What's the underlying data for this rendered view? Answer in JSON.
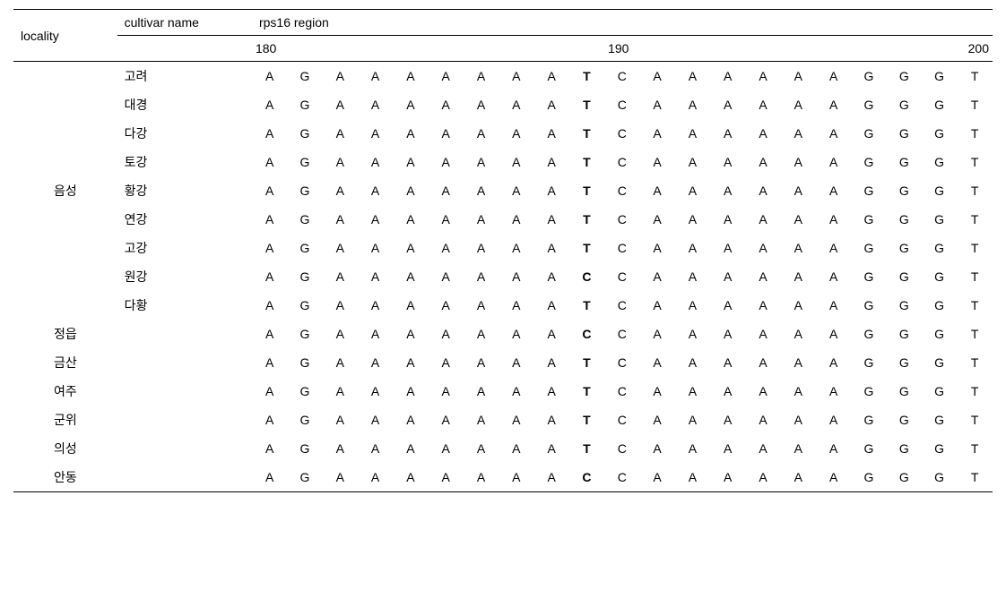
{
  "headers": {
    "locality": "locality",
    "cultivar": "cultivar name",
    "region": "rps16 region",
    "pos_start": "180",
    "pos_mid": "190",
    "pos_end": "200"
  },
  "locality_eumseong": "음성",
  "rows": [
    {
      "locality": "",
      "cultivar": "고려",
      "seq": [
        "A",
        "G",
        "A",
        "A",
        "A",
        "A",
        "A",
        "A",
        "A",
        "T",
        "C",
        "A",
        "A",
        "A",
        "A",
        "A",
        "A",
        "G",
        "G",
        "G",
        "T"
      ],
      "bold_idx": 9
    },
    {
      "locality": "",
      "cultivar": "대경",
      "seq": [
        "A",
        "G",
        "A",
        "A",
        "A",
        "A",
        "A",
        "A",
        "A",
        "T",
        "C",
        "A",
        "A",
        "A",
        "A",
        "A",
        "A",
        "G",
        "G",
        "G",
        "T"
      ],
      "bold_idx": 9
    },
    {
      "locality": "",
      "cultivar": "다강",
      "seq": [
        "A",
        "G",
        "A",
        "A",
        "A",
        "A",
        "A",
        "A",
        "A",
        "T",
        "C",
        "A",
        "A",
        "A",
        "A",
        "A",
        "A",
        "G",
        "G",
        "G",
        "T"
      ],
      "bold_idx": 9
    },
    {
      "locality": "",
      "cultivar": "토강",
      "seq": [
        "A",
        "G",
        "A",
        "A",
        "A",
        "A",
        "A",
        "A",
        "A",
        "T",
        "C",
        "A",
        "A",
        "A",
        "A",
        "A",
        "A",
        "G",
        "G",
        "G",
        "T"
      ],
      "bold_idx": 9
    },
    {
      "locality": "음성",
      "cultivar": "황강",
      "seq": [
        "A",
        "G",
        "A",
        "A",
        "A",
        "A",
        "A",
        "A",
        "A",
        "T",
        "C",
        "A",
        "A",
        "A",
        "A",
        "A",
        "A",
        "G",
        "G",
        "G",
        "T"
      ],
      "bold_idx": 9
    },
    {
      "locality": "",
      "cultivar": "연강",
      "seq": [
        "A",
        "G",
        "A",
        "A",
        "A",
        "A",
        "A",
        "A",
        "A",
        "T",
        "C",
        "A",
        "A",
        "A",
        "A",
        "A",
        "A",
        "G",
        "G",
        "G",
        "T"
      ],
      "bold_idx": 9
    },
    {
      "locality": "",
      "cultivar": "고강",
      "seq": [
        "A",
        "G",
        "A",
        "A",
        "A",
        "A",
        "A",
        "A",
        "A",
        "T",
        "C",
        "A",
        "A",
        "A",
        "A",
        "A",
        "A",
        "G",
        "G",
        "G",
        "T"
      ],
      "bold_idx": 9
    },
    {
      "locality": "",
      "cultivar": "원강",
      "seq": [
        "A",
        "G",
        "A",
        "A",
        "A",
        "A",
        "A",
        "A",
        "A",
        "C",
        "C",
        "A",
        "A",
        "A",
        "A",
        "A",
        "A",
        "G",
        "G",
        "G",
        "T"
      ],
      "bold_idx": 9
    },
    {
      "locality": "",
      "cultivar": "다황",
      "seq": [
        "A",
        "G",
        "A",
        "A",
        "A",
        "A",
        "A",
        "A",
        "A",
        "T",
        "C",
        "A",
        "A",
        "A",
        "A",
        "A",
        "A",
        "G",
        "G",
        "G",
        "T"
      ],
      "bold_idx": 9
    },
    {
      "locality": "정읍",
      "cultivar": "",
      "seq": [
        "A",
        "G",
        "A",
        "A",
        "A",
        "A",
        "A",
        "A",
        "A",
        "C",
        "C",
        "A",
        "A",
        "A",
        "A",
        "A",
        "A",
        "G",
        "G",
        "G",
        "T"
      ],
      "bold_idx": 9
    },
    {
      "locality": "금산",
      "cultivar": "",
      "seq": [
        "A",
        "G",
        "A",
        "A",
        "A",
        "A",
        "A",
        "A",
        "A",
        "T",
        "C",
        "A",
        "A",
        "A",
        "A",
        "A",
        "A",
        "G",
        "G",
        "G",
        "T"
      ],
      "bold_idx": 9
    },
    {
      "locality": "여주",
      "cultivar": "",
      "seq": [
        "A",
        "G",
        "A",
        "A",
        "A",
        "A",
        "A",
        "A",
        "A",
        "T",
        "C",
        "A",
        "A",
        "A",
        "A",
        "A",
        "A",
        "G",
        "G",
        "G",
        "T"
      ],
      "bold_idx": 9
    },
    {
      "locality": "군위",
      "cultivar": "",
      "seq": [
        "A",
        "G",
        "A",
        "A",
        "A",
        "A",
        "A",
        "A",
        "A",
        "T",
        "C",
        "A",
        "A",
        "A",
        "A",
        "A",
        "A",
        "G",
        "G",
        "G",
        "T"
      ],
      "bold_idx": 9
    },
    {
      "locality": "의성",
      "cultivar": "",
      "seq": [
        "A",
        "G",
        "A",
        "A",
        "A",
        "A",
        "A",
        "A",
        "A",
        "T",
        "C",
        "A",
        "A",
        "A",
        "A",
        "A",
        "A",
        "G",
        "G",
        "G",
        "T"
      ],
      "bold_idx": 9
    },
    {
      "locality": "안동",
      "cultivar": "",
      "seq": [
        "A",
        "G",
        "A",
        "A",
        "A",
        "A",
        "A",
        "A",
        "A",
        "C",
        "C",
        "A",
        "A",
        "A",
        "A",
        "A",
        "A",
        "G",
        "G",
        "G",
        "T"
      ],
      "bold_idx": 9
    }
  ]
}
